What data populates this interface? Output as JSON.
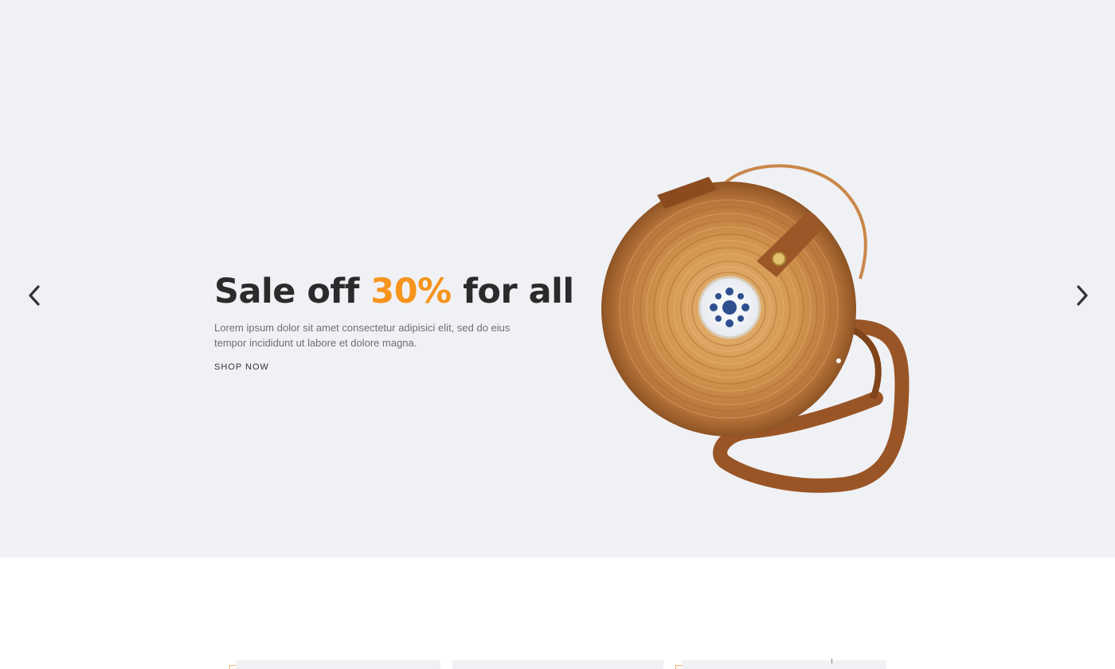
{
  "hero": {
    "title_prefix": "Sale off ",
    "title_accent": "30%",
    "title_suffix": " for all",
    "description": "Lorem ipsum dolor sit amet consectetur adipisici elit, sed do eius tempor incididunt ut labore et dolore magna.",
    "cta_label": "SHOP NOW"
  },
  "carousel": {
    "prev_icon": "chevron-left-icon",
    "next_icon": "chevron-right-icon"
  },
  "colors": {
    "accent": "#f7941d",
    "hero_background": "#f0f1f5",
    "text": "#2b2b2b"
  }
}
